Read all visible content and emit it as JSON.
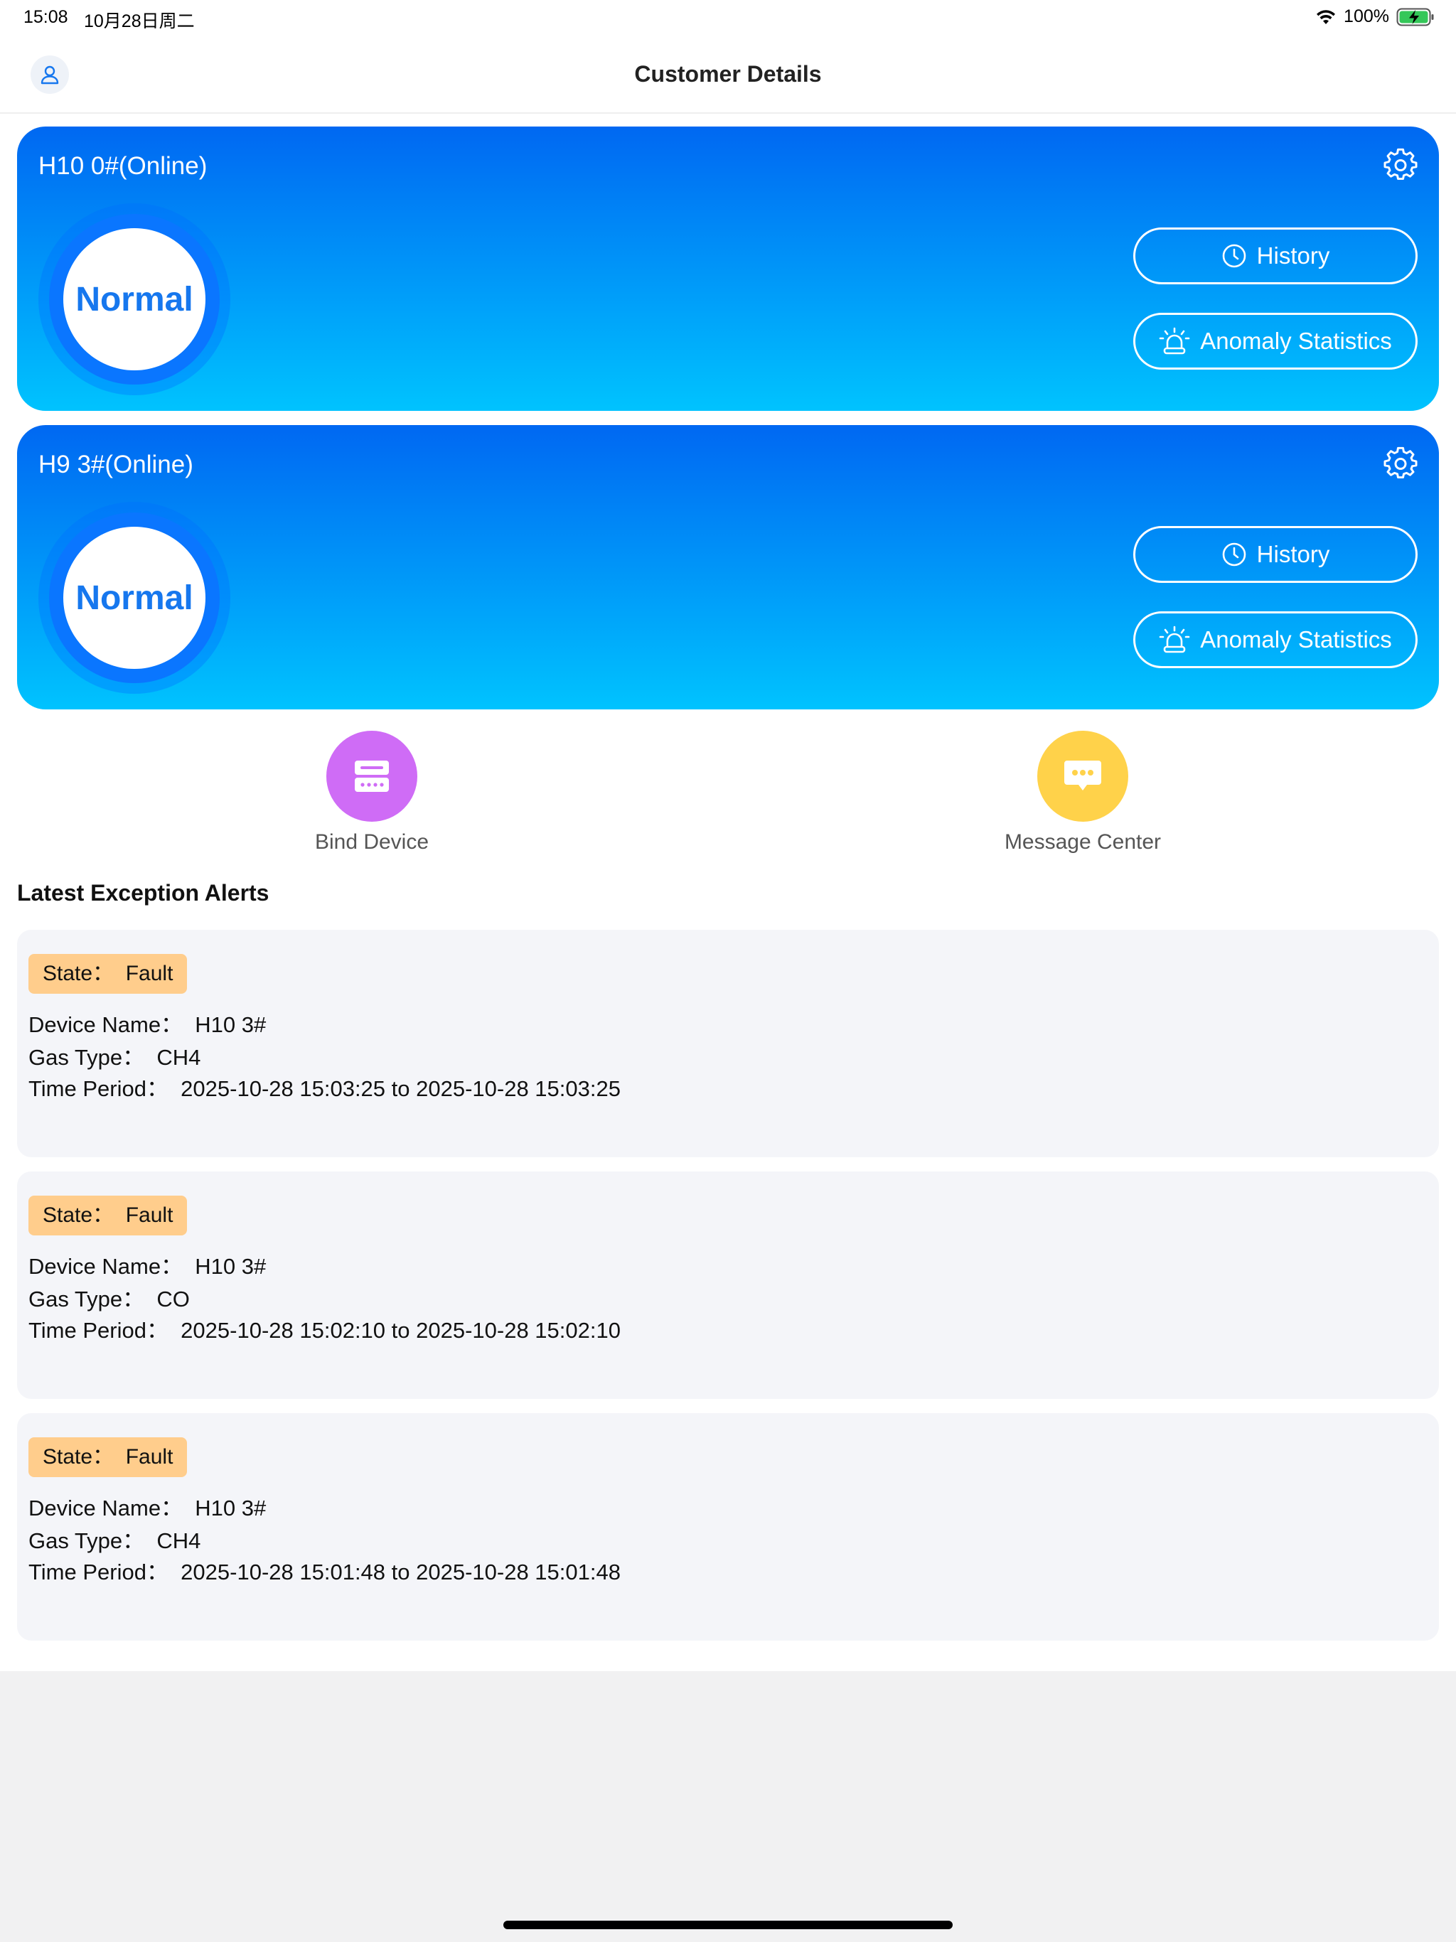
{
  "status_bar": {
    "time": "15:08",
    "date": "10月28日周二",
    "battery": "100%",
    "icons": [
      "wifi-icon",
      "battery-charging-icon"
    ]
  },
  "nav": {
    "title": "Customer Details",
    "left_icon": "user-icon"
  },
  "devices": [
    {
      "title": "H10 0#(Online)",
      "status": "Normal",
      "history_label": "History",
      "anomaly_label": "Anomaly Statistics"
    },
    {
      "title": "H9 3#(Online)",
      "status": "Normal",
      "history_label": "History",
      "anomaly_label": "Anomaly Statistics"
    }
  ],
  "quick_actions": {
    "bind_label": "Bind Device",
    "message_label": "Message Center"
  },
  "alerts_section": {
    "title": "Latest Exception Alerts",
    "items": [
      {
        "state": "State：  Fault",
        "device": "Device Name：  H10 3#",
        "gas": "Gas Type：  CH4",
        "period": "Time Period：  2025-10-28 15:03:25 to 2025-10-28 15:03:25"
      },
      {
        "state": "State：  Fault",
        "device": "Device Name：  H10 3#",
        "gas": "Gas Type：  CO",
        "period": "Time Period：  2025-10-28 15:02:10 to 2025-10-28 15:02:10"
      },
      {
        "state": "State：  Fault",
        "device": "Device Name：  H10 3#",
        "gas": "Gas Type：  CH4",
        "period": "Time Period：  2025-10-28 15:01:48 to 2025-10-28 15:01:48"
      }
    ]
  },
  "colors": {
    "card_gradient_top": "#0068f2",
    "card_gradient_bottom": "#00c3fe",
    "status_text": "#1677ee",
    "bind_device": "#cf6cf6",
    "message_center": "#ffd24a",
    "state_badge": "#ffcd8c",
    "alert_bg": "#f4f5f9"
  }
}
